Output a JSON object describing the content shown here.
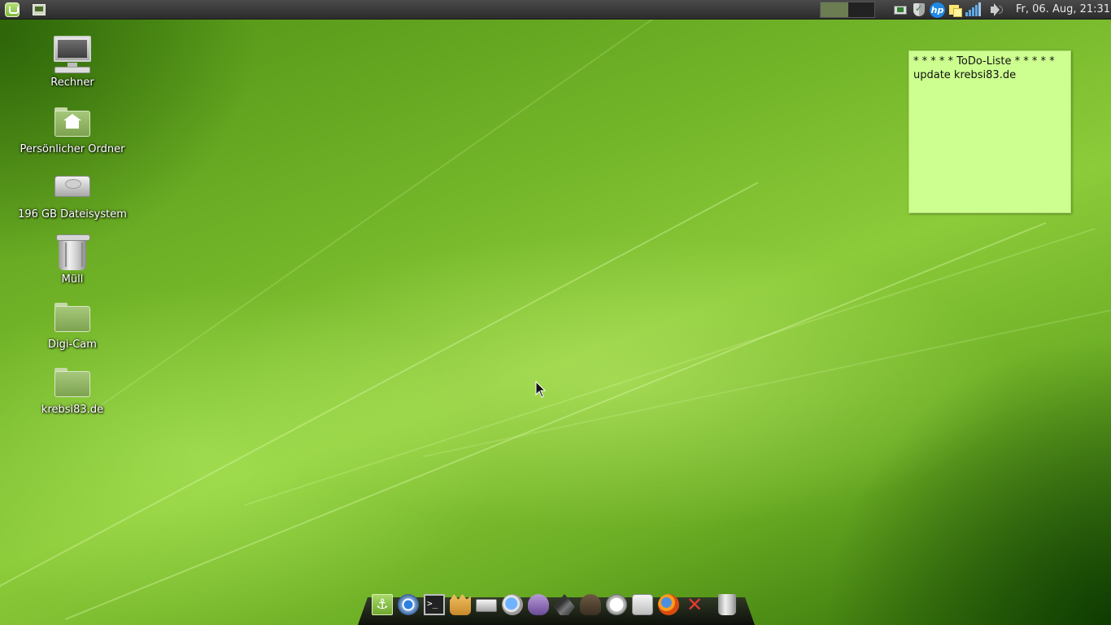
{
  "top_panel": {
    "menu_button": "mint-menu",
    "show_desktop": "show-desktop",
    "clock": "Fr, 06. Aug, 21:31",
    "tray_icons": [
      "network-icon",
      "shield-icon",
      "hp-icon",
      "sticky-notes-icon",
      "signal-icon",
      "volume-icon"
    ],
    "hp_label": "hp"
  },
  "desktop_icons": [
    {
      "label": "Rechner",
      "icon": "computer-icon"
    },
    {
      "label": "Persönlicher Ordner",
      "icon": "home-folder-icon"
    },
    {
      "label": "196 GB Dateisystem",
      "icon": "hard-drive-icon"
    },
    {
      "label": "Müll",
      "icon": "trash-icon"
    },
    {
      "label": "Digi-Cam",
      "icon": "folder-icon"
    },
    {
      "label": "krebsi83.de",
      "icon": "folder-icon"
    }
  ],
  "sticky_note": {
    "line1": "* * * * *  ToDo-Liste  * * * * *",
    "line2": "update krebsi83.de"
  },
  "dock": {
    "items": [
      "anchor-icon",
      "chromium-icon",
      "terminal-icon",
      "hand-icon",
      "scanner-icon",
      "search-icon",
      "pidgin-icon",
      "inkscape-icon",
      "gimp-icon",
      "clock-icon",
      "time-tracker-icon",
      "firefox-icon",
      "close-icon",
      "trash-icon"
    ],
    "terminal_glyph": ">_",
    "anchor_glyph": "⚓",
    "close_glyph": "✕"
  },
  "colors": {
    "panel": "#333333",
    "sticky_note": "#ccff8f",
    "desktop_green": "#73b529"
  }
}
